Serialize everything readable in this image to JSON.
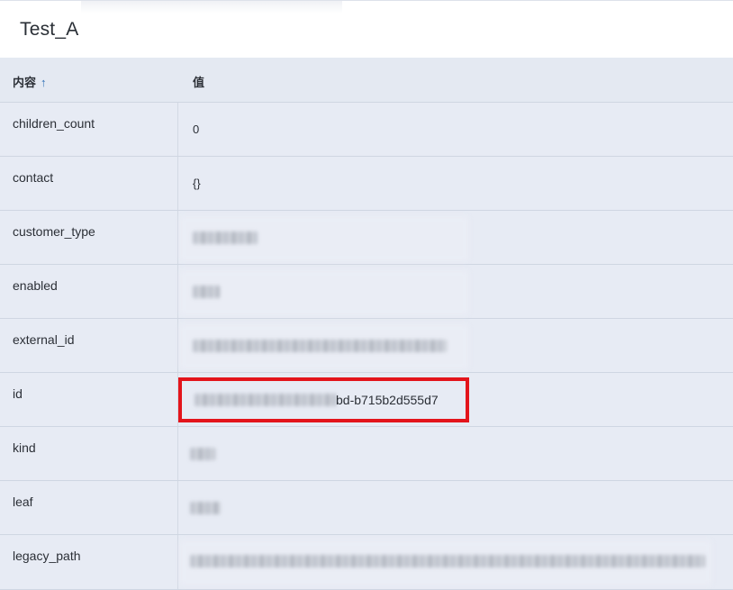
{
  "window": {
    "title": "Test_A"
  },
  "table": {
    "columns": {
      "key_label": "内容",
      "value_label": "值",
      "sort_icon": "arrow-up-icon"
    },
    "rows": [
      {
        "key": "children_count",
        "value": "0"
      },
      {
        "key": "contact",
        "value": "{}"
      },
      {
        "key": "customer_type",
        "value": ""
      },
      {
        "key": "enabled",
        "value": ""
      },
      {
        "key": "external_id",
        "value": ""
      },
      {
        "key": "id",
        "value": "bd-b715b2d555d7"
      },
      {
        "key": "kind",
        "value": ""
      },
      {
        "key": "leaf",
        "value": ""
      },
      {
        "key": "legacy_path",
        "value": ""
      }
    ]
  },
  "colors": {
    "header_bg": "#e4e9f2",
    "row_bg": "#e7ebf4",
    "highlight": "#e3141b",
    "sort_arrow": "#2f6fb6"
  }
}
